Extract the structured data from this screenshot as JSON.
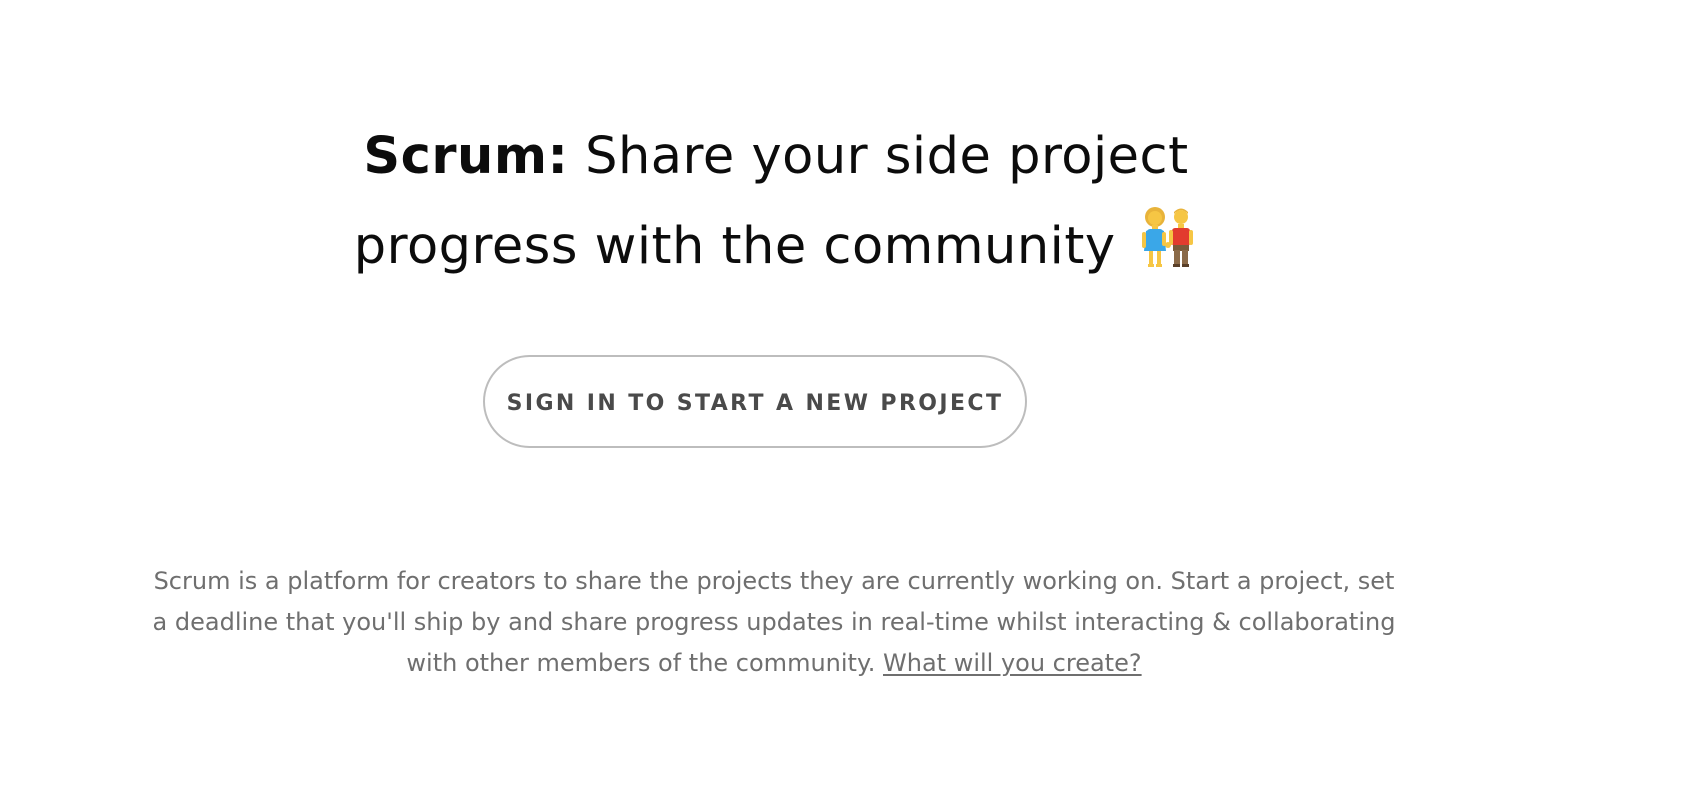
{
  "hero": {
    "brand": "Scrum:",
    "tagline_line1": "Share your side project",
    "tagline_line2": "progress with the community",
    "emoji_icon": "couple-holding-hands-icon"
  },
  "cta": {
    "label": "SIGN IN TO START A NEW PROJECT"
  },
  "description": {
    "text": "Scrum is a platform for creators to share the projects they are currently working on. Start a project, set a deadline that you'll ship by and share progress updates in real-time whilst interacting & collaborating with other members of the community.",
    "link_label": "What will you create?"
  },
  "colors": {
    "headline": "#0c0c0c",
    "body_text": "#6f6f6f",
    "button_border": "#bdbdbd",
    "button_text": "#4a4a4a"
  }
}
